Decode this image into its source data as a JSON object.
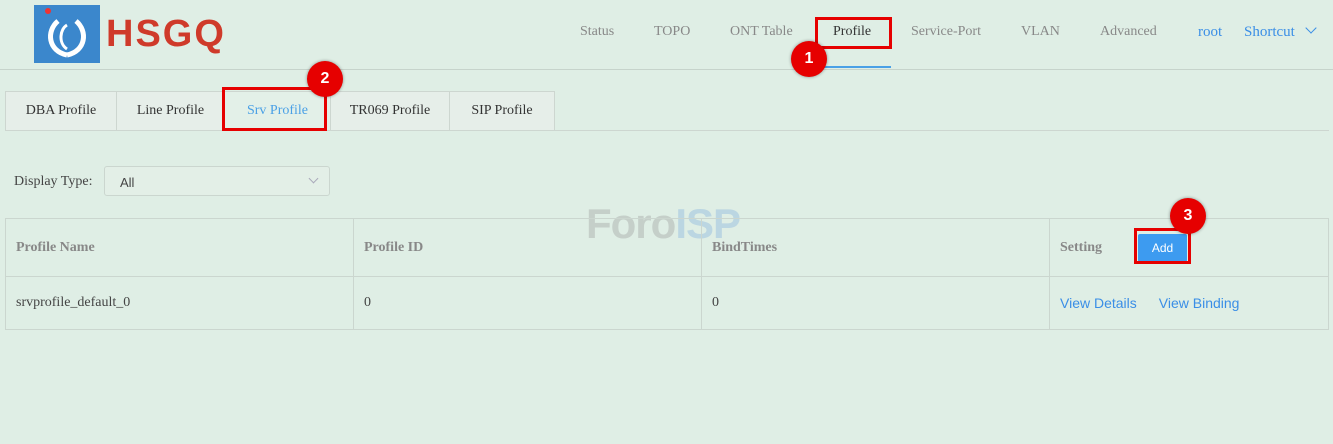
{
  "brand": {
    "name": "HSGQ",
    "logo_icon": "hsgq-logo-icon",
    "color": "#cf3a2a"
  },
  "nav": {
    "items": [
      {
        "label": "Status"
      },
      {
        "label": "TOPO"
      },
      {
        "label": "ONT Table"
      },
      {
        "label": "Profile",
        "active": true
      },
      {
        "label": "Service-Port"
      },
      {
        "label": "VLAN"
      },
      {
        "label": "Advanced"
      }
    ],
    "user": "root",
    "shortcut": "Shortcut"
  },
  "tabs": [
    {
      "label": "DBA Profile"
    },
    {
      "label": "Line Profile"
    },
    {
      "label": "Srv Profile",
      "active": true
    },
    {
      "label": "TR069 Profile"
    },
    {
      "label": "SIP Profile"
    }
  ],
  "filter": {
    "label": "Display Type:",
    "value": "All"
  },
  "table": {
    "headers": [
      "Profile Name",
      "Profile ID",
      "BindTimes",
      "Setting"
    ],
    "add_label": "Add",
    "rows": [
      {
        "name": "srvprofile_default_0",
        "id": "0",
        "bind_times": "0",
        "actions": [
          "View Details",
          "View Binding"
        ]
      }
    ]
  },
  "watermark": {
    "part1": "Foro",
    "part2": "ISP"
  },
  "annotations": {
    "badges": [
      "1",
      "2",
      "3"
    ],
    "color": "#e60000"
  },
  "colors": {
    "accent": "#3a8ee6",
    "background": "#dfeee5"
  }
}
